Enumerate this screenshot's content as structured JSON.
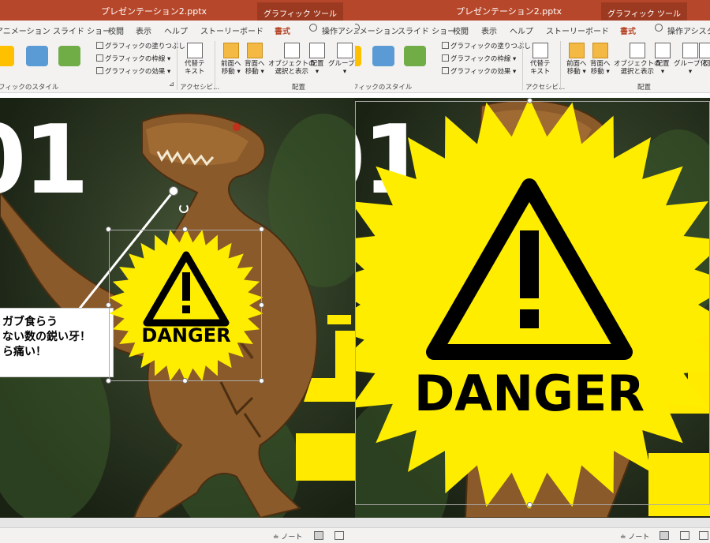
{
  "window": {
    "filename": "プレゼンテーション2.pptx",
    "context_tab": "グラフィック ツール"
  },
  "tabs": {
    "animation": "アニメーション",
    "slideshow": "スライド ショー",
    "review": "校閲",
    "view": "表示",
    "help": "ヘルプ",
    "storyboard": "ストーリーボード",
    "format": "書式",
    "tell_me": "操作アシスタ"
  },
  "ribbon": {
    "fill": "グラフィックの塗りつぶし",
    "outline": "グラフィックの枠線",
    "effects": "グラフィックの効果",
    "styles_group": "フィックのスタイル",
    "alt_text_1": "代替テ",
    "alt_text_2": "キスト",
    "accessibility_group": "アクセシビ...",
    "bring_forward_1": "前面へ",
    "bring_forward_2": "移動",
    "send_backward_1": "背面へ",
    "send_backward_2": "移動",
    "selection_pane_1": "オブジェクトの",
    "selection_pane_2": "選択と表示",
    "align": "配置",
    "group": "グループ化",
    "rotate": "回",
    "arrange_group": "配置",
    "swatch_colors": [
      "#ffc000",
      "#5b9bd5",
      "#70ad47"
    ]
  },
  "slide": {
    "number": "01",
    "callout_lines": [
      "ガブ食らう",
      "ない数の鋭い牙！",
      "ら痛い！"
    ],
    "callout_fragment_right": "痛",
    "danger_label": "DANGER",
    "danger_color": "#ffed00"
  },
  "statusbar": {
    "notes": "ノート"
  }
}
